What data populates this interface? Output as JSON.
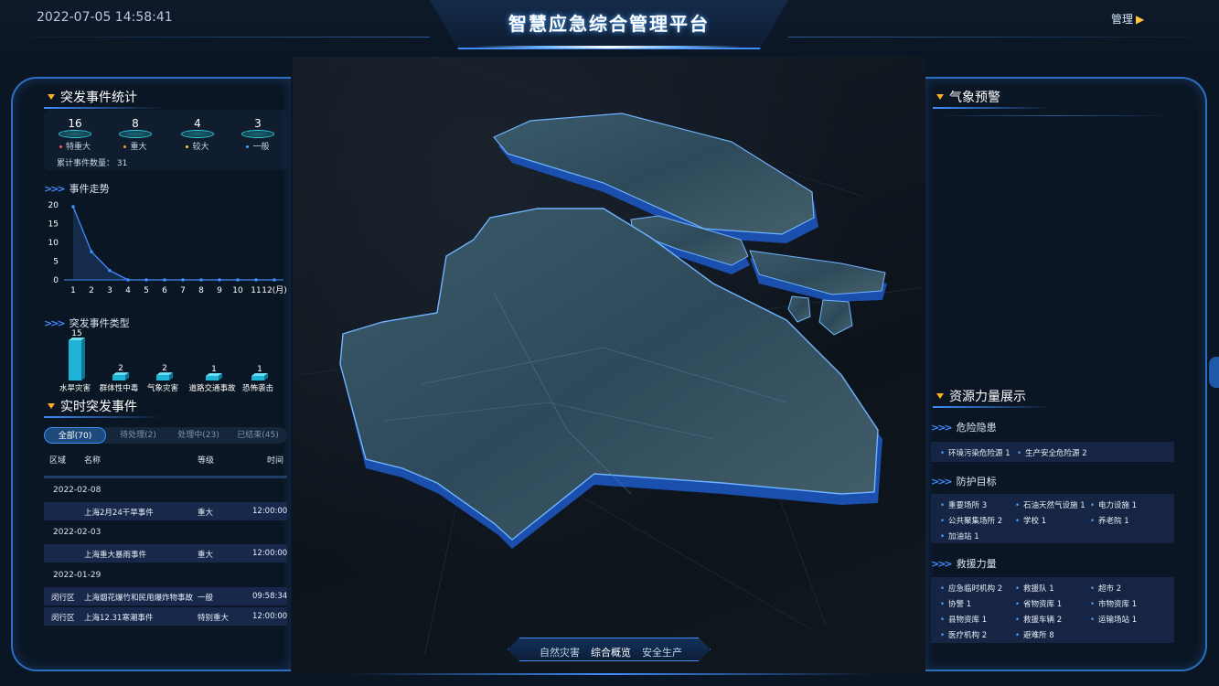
{
  "header": {
    "datetime": "2022-07-05 14:58:41",
    "title": "智慧应急综合管理平台",
    "admin_label": "管理"
  },
  "incident_stats": {
    "title": "突发事件统计",
    "items": [
      {
        "value": "16",
        "label": "特重大",
        "color": "#ff5a5a"
      },
      {
        "value": "8",
        "label": "重大",
        "color": "#ff9a3d"
      },
      {
        "value": "4",
        "label": "较大",
        "color": "#ffd23d"
      },
      {
        "value": "3",
        "label": "一般",
        "color": "#3fa8ff"
      }
    ],
    "total_label": "累计事件数量：",
    "total_value": "31"
  },
  "trend": {
    "title": "事件走势"
  },
  "types": {
    "title": "突发事件类型"
  },
  "chart_data": [
    {
      "type": "line",
      "title": "事件走势",
      "categories": [
        "1",
        "2",
        "3",
        "4",
        "5",
        "6",
        "7",
        "8",
        "9",
        "10",
        "11",
        "12(月)"
      ],
      "values": [
        19.5,
        7.5,
        2.5,
        0,
        0,
        0,
        0,
        0,
        0,
        0,
        0,
        0
      ],
      "yticks": [
        "0",
        "5",
        "10",
        "15",
        "20"
      ],
      "ylim": [
        0,
        20
      ],
      "color": "#3f8cff"
    },
    {
      "type": "bar",
      "title": "突发事件类型",
      "categories": [
        "水旱灾害",
        "群体性中毒",
        "气象灾害",
        "道路交通事故",
        "恐怖袭击"
      ],
      "values": [
        15,
        2,
        2,
        1,
        1
      ],
      "color": "#1fb4d6"
    }
  ],
  "realtime": {
    "title": "实时突发事件",
    "tabs": [
      {
        "label": "全部(70)",
        "active": true
      },
      {
        "label": "待处理(2)",
        "active": false
      },
      {
        "label": "处理中(23)",
        "active": false
      },
      {
        "label": "已结束(45)",
        "active": false
      }
    ],
    "columns": [
      "区域",
      "名称",
      "等级",
      "时间"
    ],
    "groups": [
      {
        "date": "2022-02-08",
        "rows": [
          {
            "area": "",
            "name": "上海2月24干旱事件",
            "level": "重大",
            "time": "12:00:00"
          }
        ]
      },
      {
        "date": "2022-02-03",
        "rows": [
          {
            "area": "",
            "name": "上海重大暴雨事件",
            "level": "重大",
            "time": "12:00:00"
          }
        ]
      },
      {
        "date": "2022-01-29",
        "rows": [
          {
            "area": "闵行区",
            "name": "上海烟花爆竹和民用爆炸物事故",
            "level": "一般",
            "time": "09:58:34"
          },
          {
            "area": "闵行区",
            "name": "上海12.31寒潮事件",
            "level": "特别重大",
            "time": "12:00:00"
          }
        ]
      }
    ]
  },
  "weather": {
    "title": "气象预警"
  },
  "resources": {
    "title": "资源力量展示",
    "hazards": {
      "title": "危险隐患",
      "items": [
        "环境污染危险源 1",
        "生产安全危险源 2"
      ]
    },
    "targets": {
      "title": "防护目标",
      "items": [
        "重要场所 3",
        "石油天然气设施 1",
        "电力设施 1",
        "公共聚集场所 2",
        "学校 1",
        "养老院 1",
        "加油站 1"
      ]
    },
    "rescue": {
      "title": "救援力量",
      "items": [
        "应急临时机构 2",
        "救援队 1",
        "超市 2",
        "协警 1",
        "省物资库 1",
        "市物资库 1",
        "县物资库 1",
        "救援车辆 2",
        "运输场站 1",
        "医疗机构 2",
        "避难所 8"
      ]
    }
  },
  "bottom_nav": {
    "items": [
      "自然灾害",
      "综合概览",
      "安全生产"
    ],
    "active_index": 1
  }
}
